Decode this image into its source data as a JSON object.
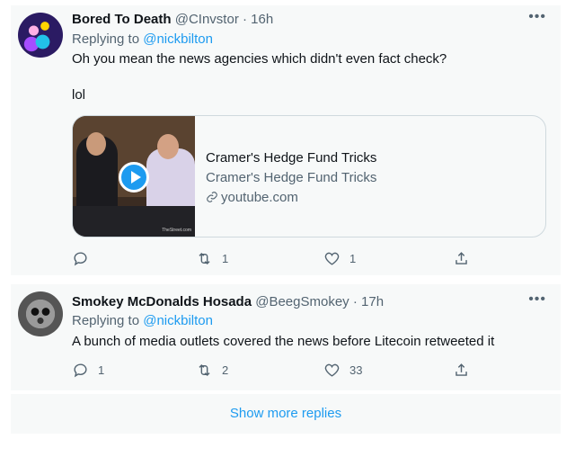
{
  "tweets": [
    {
      "display_name": "Bored To Death",
      "handle": "@CInvstor",
      "time": "16h",
      "replying_prefix": "Replying to",
      "replying_to": "@nickbilton",
      "text_line1": "Oh you mean the news agencies which didn't even fact check?",
      "text_line2": "lol",
      "card": {
        "title": "Cramer's Hedge Fund Tricks",
        "subtitle": "Cramer's Hedge Fund Tricks",
        "domain": "youtube.com",
        "thumb_watermark": "TheStreet.com"
      },
      "actions": {
        "replies": "",
        "retweets": "1",
        "likes": "1"
      }
    },
    {
      "display_name": "Smokey McDonalds Hosada",
      "handle": "@BeegSmokey",
      "time": "17h",
      "replying_prefix": "Replying to",
      "replying_to": "@nickbilton",
      "text": "A bunch of media outlets covered the news before Litecoin retweeted it",
      "actions": {
        "replies": "1",
        "retweets": "2",
        "likes": "33"
      }
    }
  ],
  "show_more_label": "Show more replies",
  "icons": {
    "more": "more-horizontal-icon",
    "reply": "reply-icon",
    "retweet": "retweet-icon",
    "like": "heart-icon",
    "share": "share-icon",
    "link": "link-icon",
    "play": "play-icon"
  },
  "colors": {
    "accent": "#1d9bf0",
    "secondary_text": "#536471",
    "background": "#f7f9f9"
  }
}
